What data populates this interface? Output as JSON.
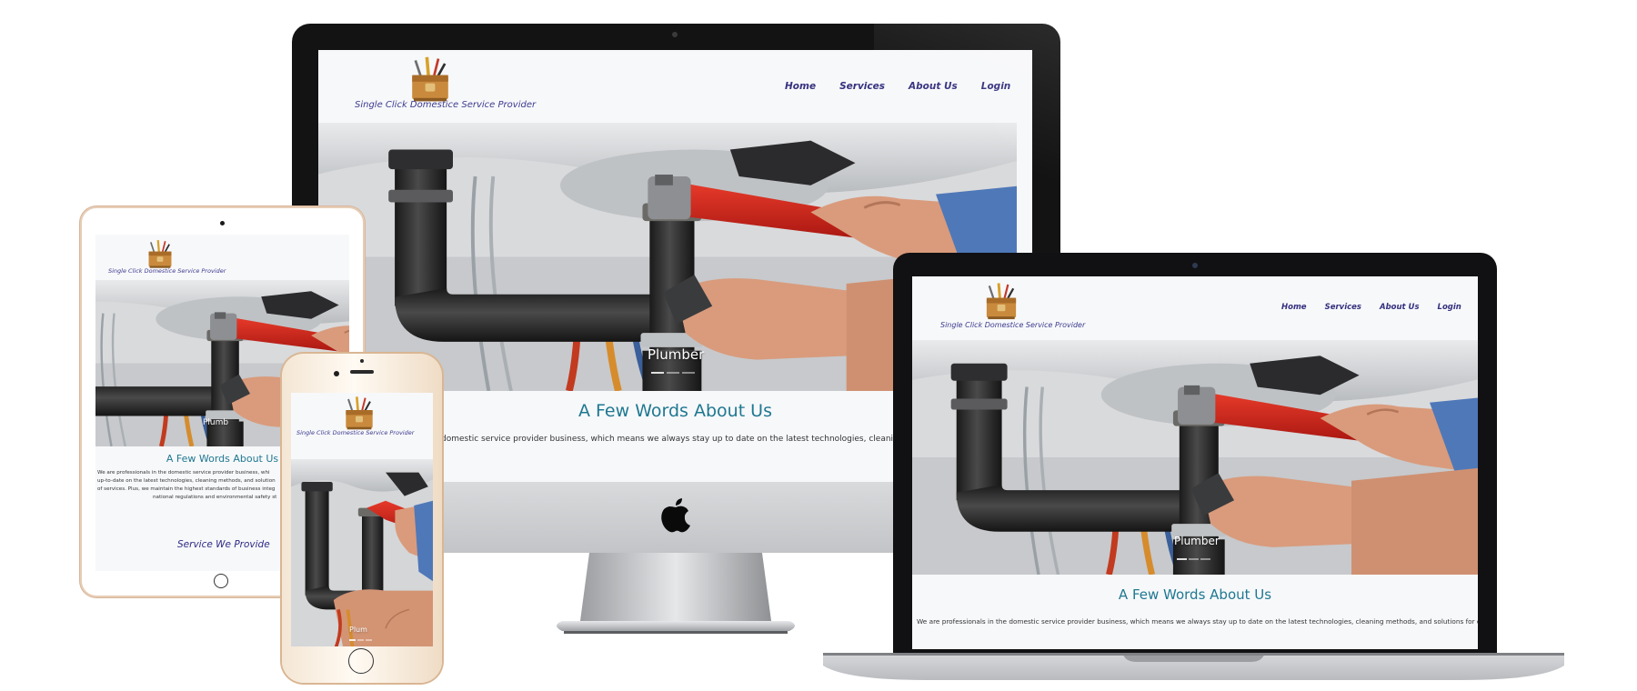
{
  "site": {
    "brand_text": "Single Click Domestice Service Provider",
    "nav": [
      "Home",
      "Services",
      "About Us",
      "Login"
    ],
    "slide_caption": "Plumber",
    "about_heading": "A Few Words About Us",
    "about_text_desktop": "domestic service provider business, which means we always stay up to date on the latest technologies, cleaning m",
    "about_text_laptop": "We are professionals in the domestic service provider business, which means we always stay up to date on the latest technologies, cleaning methods, and solutions for dealing",
    "about_text_tablet_lines": [
      "We are professionals in the domestic service provider business, whi",
      "up-to-date on the latest technologies, cleaning methods, and solution",
      "of services. Plus, we maintain the highest standards of business integ",
      "national regulations and environmental safety st"
    ],
    "services_heading": "Service We Provide",
    "tablet_caption": "Plumb",
    "phone_caption": "Plum"
  },
  "colors": {
    "brand": "#3d3a8f",
    "heading": "#1f7891",
    "background": "#f7f8fa"
  },
  "icons": [
    "toolbox-logo-icon",
    "apple-logo-icon",
    "home-button-icon",
    "camera-icon"
  ]
}
